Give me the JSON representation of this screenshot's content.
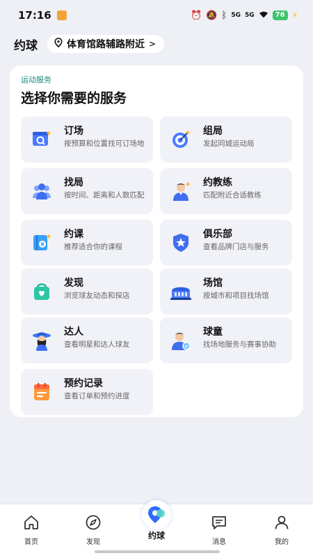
{
  "status_bar": {
    "time": "17:16",
    "signal1": "5G",
    "signal2": "5G",
    "battery": "76"
  },
  "header": {
    "title": "约球",
    "location": "体育馆路辅路附近",
    "location_chevron": ">"
  },
  "card": {
    "tag": "运动服务",
    "title": "选择你需要的服务",
    "services": [
      {
        "name": "订场",
        "desc": "按预算和位置找可订场地",
        "icon": "calendar-search-icon"
      },
      {
        "name": "组局",
        "desc": "发起同城运动局",
        "icon": "target-icon"
      },
      {
        "name": "找局",
        "desc": "按时间、距离和人数匹配",
        "icon": "people-group-icon"
      },
      {
        "name": "约教练",
        "desc": "匹配附近合适教练",
        "icon": "coach-icon"
      },
      {
        "name": "约课",
        "desc": "推荐适合你的课程",
        "icon": "course-book-icon"
      },
      {
        "name": "俱乐部",
        "desc": "查看品牌门店与服务",
        "icon": "club-shield-icon"
      },
      {
        "name": "发现",
        "desc": "浏览球友动态和探店",
        "icon": "discover-bag-icon"
      },
      {
        "name": "场馆",
        "desc": "按城市和项目找场馆",
        "icon": "stadium-icon"
      },
      {
        "name": "达人",
        "desc": "查看明星和达人球友",
        "icon": "expert-avatar-icon"
      },
      {
        "name": "球童",
        "desc": "找场地服务与赛事协助",
        "icon": "ball-boy-icon"
      },
      {
        "name": "预约记录",
        "desc": "查看订单和预约进度",
        "icon": "booking-record-icon"
      }
    ]
  },
  "nav": {
    "items": [
      {
        "label": "首页",
        "icon": "home-icon"
      },
      {
        "label": "发现",
        "icon": "compass-icon"
      },
      {
        "label": "约球",
        "icon": "yueqiu-logo-icon"
      },
      {
        "label": "消息",
        "icon": "message-icon"
      },
      {
        "label": "我的",
        "icon": "profile-icon"
      }
    ],
    "active_index": 2,
    "active_color": "#2f6bff"
  }
}
